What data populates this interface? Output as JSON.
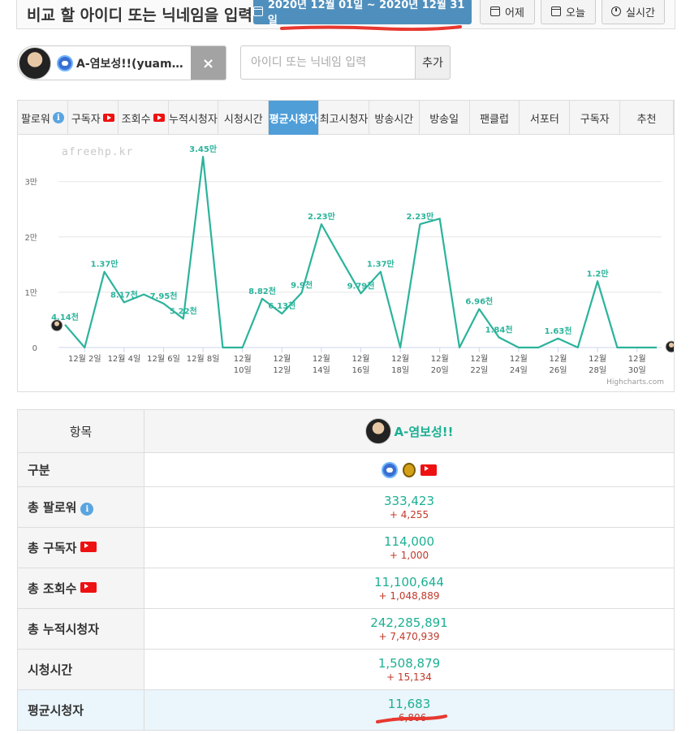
{
  "header": {
    "title": "비교 할 아이디 또는 닉네임을 입력",
    "date_range": "2020년 12월 01일 ~ 2020년 12월 31일",
    "buttons": {
      "yesterday": "어제",
      "today": "오늘",
      "realtime": "실시간"
    }
  },
  "user_chip": {
    "name": "A-염보성!!(yuam…",
    "close": "×"
  },
  "search": {
    "placeholder": "아이디 또는 닉네임 입력",
    "add_label": "추가"
  },
  "tabs": [
    {
      "label": "팔로워",
      "badge": "info"
    },
    {
      "label": "구독자",
      "badge": "youtube"
    },
    {
      "label": "조회수",
      "badge": "youtube"
    },
    {
      "label": "누적시청자"
    },
    {
      "label": "시청시간"
    },
    {
      "label": "평균시청자",
      "active": true
    },
    {
      "label": "최고시청자"
    },
    {
      "label": "방송시간"
    },
    {
      "label": "방송일"
    },
    {
      "label": "팬클럽"
    },
    {
      "label": "서포터"
    },
    {
      "label": "구독자"
    },
    {
      "label": "추천"
    }
  ],
  "chart_watermark": "afreehp.kr",
  "chart_credits": "Highcharts.com",
  "chart_data": {
    "type": "line",
    "x": [
      1,
      2,
      3,
      4,
      5,
      6,
      7,
      8,
      9,
      10,
      11,
      12,
      13,
      14,
      15,
      16,
      17,
      18,
      19,
      20,
      21,
      22,
      23,
      24,
      25,
      26,
      27,
      28,
      29,
      30,
      31
    ],
    "values": [
      4140,
      0,
      13700,
      8170,
      9600,
      7950,
      5220,
      34500,
      0,
      0,
      8820,
      6130,
      9900,
      22300,
      16000,
      9790,
      13700,
      0,
      22300,
      23300,
      0,
      6960,
      1840,
      0,
      0,
      1630,
      0,
      12000,
      0,
      0,
      0
    ],
    "data_labels": {
      "1": "4.14천",
      "3": "1.37만",
      "4": "8.17천",
      "6": "7.95천",
      "7": "5.22천",
      "8": "3.45만",
      "11": "8.82천",
      "12": "6.13천",
      "13": "9.9천",
      "14": "2.23만",
      "16": "9.79천",
      "17": "1.37만",
      "19": "2.23만",
      "22": "6.96천",
      "23": "1.84천",
      "26": "1.63천",
      "28": "1.2만"
    },
    "x_tick_labels": [
      {
        "x": 2,
        "label": "12월 2일"
      },
      {
        "x": 4,
        "label": "12월 4일"
      },
      {
        "x": 6,
        "label": "12월 6일"
      },
      {
        "x": 8,
        "label": "12월 8일"
      },
      {
        "x": 10,
        "label": "12월\n10일"
      },
      {
        "x": 12,
        "label": "12월\n12일"
      },
      {
        "x": 14,
        "label": "12월\n14일"
      },
      {
        "x": 16,
        "label": "12월\n16일"
      },
      {
        "x": 18,
        "label": "12월\n18일"
      },
      {
        "x": 20,
        "label": "12월\n20일"
      },
      {
        "x": 22,
        "label": "12월\n22일"
      },
      {
        "x": 24,
        "label": "12월\n24일"
      },
      {
        "x": 26,
        "label": "12월\n26일"
      },
      {
        "x": 28,
        "label": "12월\n28일"
      },
      {
        "x": 30,
        "label": "12월\n30일"
      }
    ],
    "y_ticks": [
      {
        "v": 0,
        "label": "0"
      },
      {
        "v": 10000,
        "label": "1만"
      },
      {
        "v": 20000,
        "label": "2만"
      },
      {
        "v": 30000,
        "label": "3만"
      }
    ],
    "ylim": [
      0,
      37000
    ],
    "color": "#2bb39b"
  },
  "table": {
    "header_label": "항목",
    "user_name": "A-염보성!!",
    "rows": [
      {
        "label": "구분",
        "type": "icons"
      },
      {
        "label": "총 팔로워",
        "badge": "info",
        "value": "333,423",
        "diff": "+ 4,255"
      },
      {
        "label": "총 구독자",
        "badge": "youtube",
        "value": "114,000",
        "diff": "+ 1,000"
      },
      {
        "label": "총 조회수",
        "badge": "youtube",
        "value": "11,100,644",
        "diff": "+ 1,048,889"
      },
      {
        "label": "총 누적시청자",
        "value": "242,285,891",
        "diff": "+ 7,470,939"
      },
      {
        "label": "시청시간",
        "value": "1,508,879",
        "diff": "+ 15,134"
      },
      {
        "label": "평균시청자",
        "value": "11,683",
        "diff": "- 6,806",
        "highlight": true
      }
    ]
  },
  "colors": {
    "accent": "#4f8fbd",
    "line": "#2bb39b",
    "diff": "#c0392b",
    "annotation": "#e8382f"
  }
}
